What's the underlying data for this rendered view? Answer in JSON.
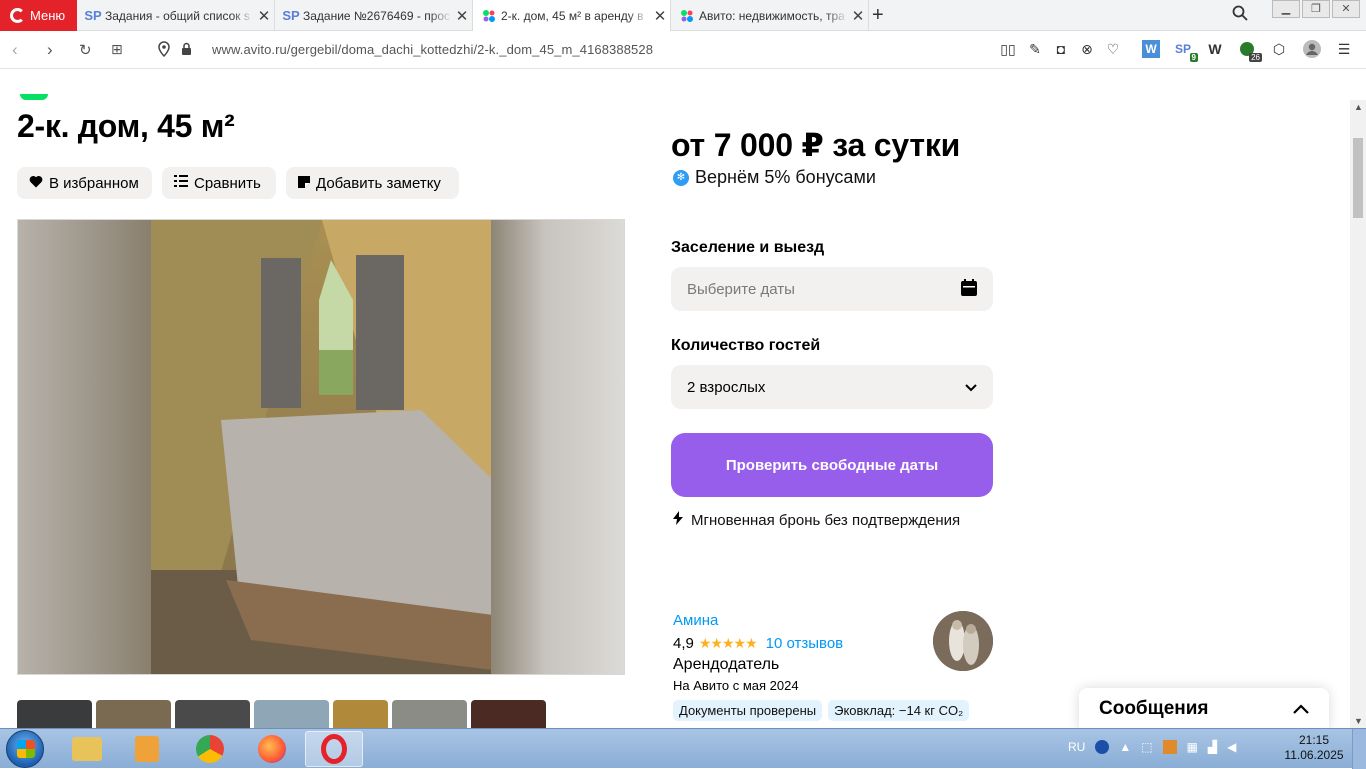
{
  "browser": {
    "menu_label": "Меню",
    "tabs": [
      {
        "title": "Задания - общий список s",
        "icon": "SP",
        "active": false
      },
      {
        "title": "Задание №2676469 - прос",
        "icon": "SP",
        "active": false
      },
      {
        "title": "2-к. дом, 45 м² в аренду в",
        "icon": "avito",
        "active": true
      },
      {
        "title": "Авито: недвижимость, тра",
        "icon": "avito",
        "active": false
      }
    ],
    "url": "www.avito.ru/gergebil/doma_dachi_kottedzhi/2-k._dom_45_m_4168388528",
    "ext_badges": {
      "sp": "9",
      "cx": "26"
    },
    "ext_w_label": "W",
    "ext_sp_label": "SP"
  },
  "listing": {
    "title": "2-к. дом, 45 м²",
    "actions": {
      "favorite": "В избранном",
      "compare": "Сравнить",
      "note": "Добавить заметку"
    }
  },
  "booking": {
    "price": "от 7 000 ₽ за сутки",
    "bonus": "Вернём 5% бонусами",
    "dates_label": "Заселение и выезд",
    "dates_placeholder": "Выберите даты",
    "guests_label": "Количество гостей",
    "guests_value": "2 взрослых",
    "check_button": "Проверить свободные даты",
    "instant": "Мгновенная бронь без подтверждения"
  },
  "seller": {
    "name": "Амина",
    "rating": "4,9",
    "stars": "★★★★★",
    "reviews": "10 отзывов",
    "role": "Арендодатель",
    "since": "На Авито с мая 2024",
    "chips": [
      "Документы проверены",
      "Эковклад: −14 кг CO₂"
    ]
  },
  "messages": {
    "label": "Сообщения"
  },
  "taskbar": {
    "lang": "RU",
    "time": "21:15",
    "date": "11.06.2025"
  },
  "colors": {
    "accent_purple": "#965eeb",
    "avito_blue": "#0099f7",
    "opera_red": "#e3222a"
  }
}
